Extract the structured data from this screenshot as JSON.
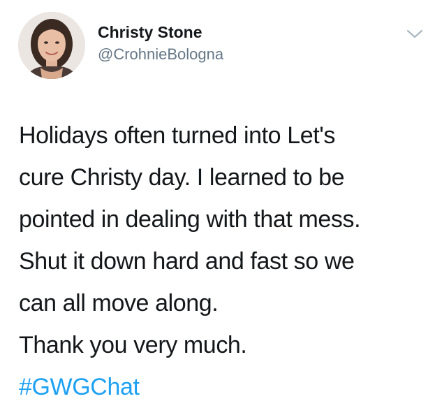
{
  "author": {
    "display_name": "Christy Stone",
    "handle": "@CrohnieBologna",
    "avatar_icon": "user-avatar-photo"
  },
  "menu": {
    "icon": "chevron-down-icon"
  },
  "tweet": {
    "lines": [
      "Holidays often turned into Let's",
      "cure Christy day. I learned to be",
      "pointed in dealing with that mess.",
      "Shut it down hard and fast so we",
      "can all move along.",
      "Thank you very much."
    ],
    "hashtag": "#GWGChat"
  },
  "colors": {
    "text": "#14171a",
    "secondary_text": "#657786",
    "link": "#1da1f2",
    "chevron": "#aab8c2"
  }
}
